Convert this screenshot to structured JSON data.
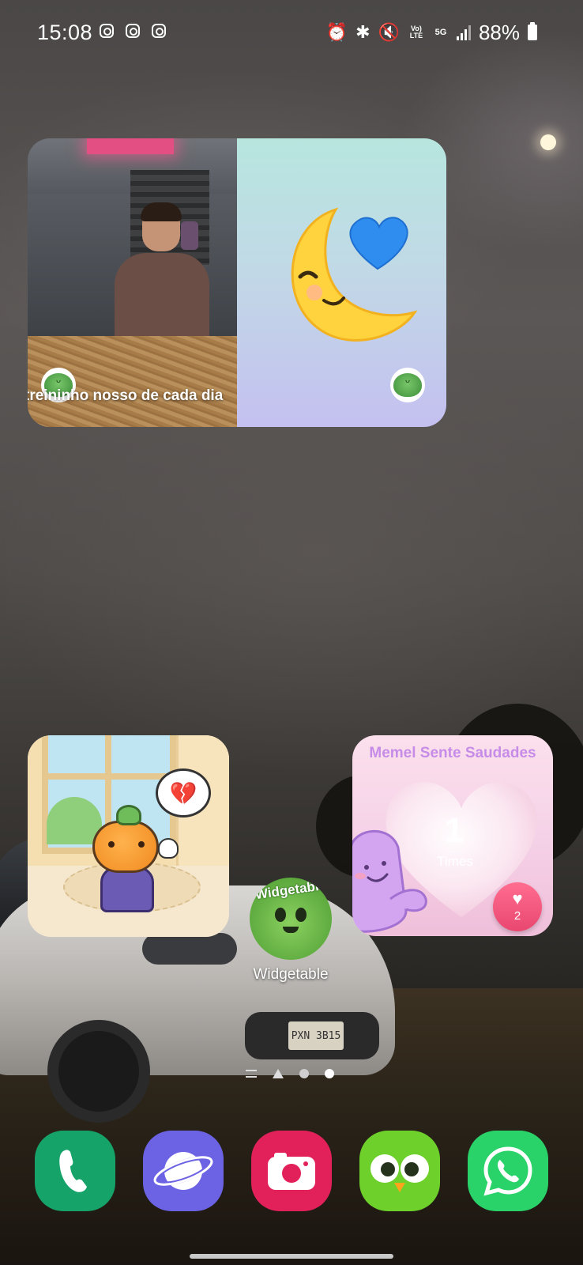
{
  "status_bar": {
    "time": "15:08",
    "notification_icons": [
      "instagram-icon",
      "instagram-icon",
      "instagram-icon"
    ],
    "system_icons": [
      "alarm-icon",
      "bluetooth-icon",
      "mute-icon",
      "volte-icon",
      "5g-icon",
      "signal-icon"
    ],
    "volte_label": "Vo) LTE",
    "network_label": "5G",
    "battery_percent": "88%"
  },
  "photo_widget": {
    "caption": "treininho nosso de cada dia",
    "right_emoji": "moon-with-blue-heart"
  },
  "pumpkin_widget": {
    "character": "pumpkin-wizard",
    "bubble_icon": "broken-heart-icon"
  },
  "memel_widget": {
    "title": "Memel Sente Saudades",
    "count": "1",
    "count_label": "Times",
    "heart_button_count": "2"
  },
  "widgetable_app": {
    "icon_text": "Widgetable",
    "label": "Widgetable"
  },
  "page_indicator": {
    "pages": 3,
    "active_page": 3
  },
  "car_plate": "PXN 3B15",
  "dock": [
    "phone-icon",
    "samsung-internet-icon",
    "camera-icon",
    "duolingo-icon",
    "whatsapp-icon"
  ],
  "colors": {
    "memel_title": "#c68ce8",
    "phone": "#16a36a",
    "internet": "#6c63e4",
    "camera": "#e2205a",
    "duolingo": "#6ed02b",
    "whatsapp": "#2ad36a"
  }
}
